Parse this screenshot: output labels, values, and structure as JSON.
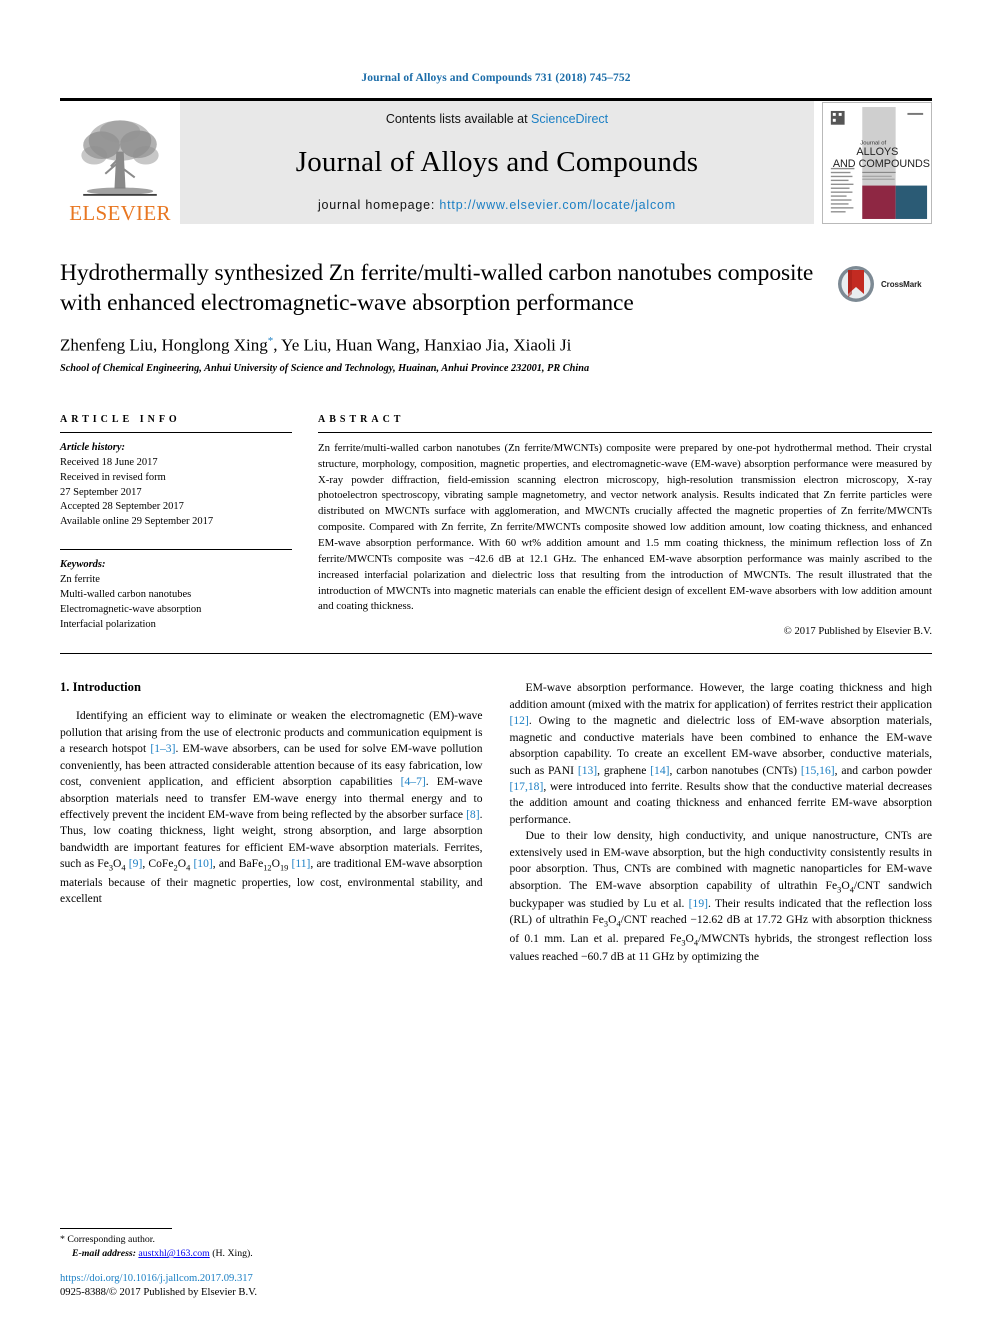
{
  "running_head": "Journal of Alloys and Compounds 731 (2018) 745–752",
  "masthead": {
    "publisher_name": "ELSEVIER",
    "contents_prefix": "Contents lists available at ",
    "contents_link": "ScienceDirect",
    "journal_title": "Journal of Alloys and Compounds",
    "homepage_prefix": "journal homepage: ",
    "homepage_url": "http://www.elsevier.com/locate/jalcom",
    "cover": {
      "line_small_top": "Journal of",
      "line_alloys": "ALLOYS",
      "line_compounds": "AND COMPOUNDS",
      "red_hex": "#8e2743",
      "teal_hex": "#2b5b75",
      "gray_hex": "#cfcfcf"
    }
  },
  "article": {
    "title": "Hydrothermally synthesized Zn ferrite/multi-walled carbon nanotubes composite with enhanced electromagnetic-wave absorption performance",
    "authors_html": "Zhenfeng Liu, Honglong Xing<sup>*</sup>, Ye Liu, Huan Wang, Hanxiao Jia, Xiaoli Ji",
    "affiliation": "School of Chemical Engineering, Anhui University of Science and Technology, Huainan, Anhui Province 232001, PR China",
    "crossmark_label": "CrossMark"
  },
  "article_info": {
    "heading": "ARTICLE INFO",
    "history_label": "Article history:",
    "history": [
      "Received 18 June 2017",
      "Received in revised form",
      "27 September 2017",
      "Accepted 28 September 2017",
      "Available online 29 September 2017"
    ],
    "keywords_label": "Keywords:",
    "keywords": [
      "Zn ferrite",
      "Multi-walled carbon nanotubes",
      "Electromagnetic-wave absorption",
      "Interfacial polarization"
    ]
  },
  "abstract": {
    "heading": "ABSTRACT",
    "text": "Zn ferrite/multi-walled carbon nanotubes (Zn ferrite/MWCNTs) composite were prepared by one-pot hydrothermal method. Their crystal structure, morphology, composition, magnetic properties, and electromagnetic-wave (EM-wave) absorption performance were measured by X-ray powder diffraction, field-emission scanning electron microscopy, high-resolution transmission electron microscopy, X-ray photoelectron spectroscopy, vibrating sample magnetometry, and vector network analysis. Results indicated that Zn ferrite particles were distributed on MWCNTs surface with agglomeration, and MWCNTs crucially affected the magnetic properties of Zn ferrite/MWCNTs composite. Compared with Zn ferrite, Zn ferrite/MWCNTs composite showed low addition amount, low coating thickness, and enhanced EM-wave absorption performance. With 60 wt% addition amount and 1.5 mm coating thickness, the minimum reflection loss of Zn ferrite/MWCNTs composite was −42.6 dB at 12.1 GHz. The enhanced EM-wave absorption performance was mainly ascribed to the increased interfacial polarization and dielectric loss that resulting from the introduction of MWCNTs. The result illustrated that the introduction of MWCNTs into magnetic materials can enable the efficient design of excellent EM-wave absorbers with low addition amount and coating thickness.",
    "copyright": "© 2017 Published by Elsevier B.V."
  },
  "introduction": {
    "section_number_title": "1. Introduction",
    "left_paragraph_html": "Identifying an efficient way to eliminate or weaken the electromagnetic (EM)-wave pollution that arising from the use of electronic products and communication equipment is a research hotspot <span class=\"ref\">[1–3]</span>. EM-wave absorbers, can be used for solve EM-wave pollution conveniently, has been attracted considerable attention because of its easy fabrication, low cost, convenient application, and efficient absorption capabilities <span class=\"ref\">[4–7]</span>. EM-wave absorption materials need to transfer EM-wave energy into thermal energy and to effectively prevent the incident EM-wave from being reflected by the absorber surface <span class=\"ref\">[8]</span>. Thus, low coating thickness, light weight, strong absorption, and large absorption bandwidth are important features for efficient EM-wave absorption materials. Ferrites, such as Fe<sub>3</sub>O<sub>4</sub> <span class=\"ref\">[9]</span>, CoFe<sub>2</sub>O<sub>4</sub> <span class=\"ref\">[10]</span>, and BaFe<sub>12</sub>O<sub>19</sub> <span class=\"ref\">[11]</span>, are traditional EM-wave absorption materials because of their magnetic properties, low cost, environmental stability, and excellent",
    "right_paragraph_1_html": "EM-wave absorption performance. However, the large coating thickness and high addition amount (mixed with the matrix for application) of ferrites restrict their application <span class=\"ref\">[12]</span>. Owing to the magnetic and dielectric loss of EM-wave absorption materials, magnetic and conductive materials have been combined to enhance the EM-wave absorption capability. To create an excellent EM-wave absorber, conductive materials, such as PANI <span class=\"ref\">[13]</span>, graphene <span class=\"ref\">[14]</span>, carbon nanotubes (CNTs) <span class=\"ref\">[15,16]</span>, and carbon powder <span class=\"ref\">[17,18]</span>, were introduced into ferrite. Results show that the conductive material decreases the addition amount and coating thickness and enhanced ferrite EM-wave absorption performance.",
    "right_paragraph_2_html": "Due to their low density, high conductivity, and unique nanostructure, CNTs are extensively used in EM-wave absorption, but the high conductivity consistently results in poor absorption. Thus, CNTs are combined with magnetic nanoparticles for EM-wave absorption. The EM-wave absorption capability of ultrathin Fe<sub>3</sub>O<sub>4</sub>/CNT sandwich buckypaper was studied by Lu et al. <span class=\"ref\">[19]</span>. Their results indicated that the reflection loss (RL) of ultrathin Fe<sub>3</sub>O<sub>4</sub>/CNT reached −12.62 dB at 17.72 GHz with absorption thickness of 0.1 mm. Lan et al. prepared Fe<sub>3</sub>O<sub>4</sub>/MWCNTs hybrids, the strongest reflection loss values reached −60.7 dB at 11 GHz by optimizing the"
  },
  "footer": {
    "corresponding_author": "* Corresponding author.",
    "email_label": "E-mail address:",
    "email": "austxhl@163.com",
    "email_suffix": "(H. Xing).",
    "doi": "https://doi.org/10.1016/j.jallcom.2017.09.317",
    "issn_line": "0925-8388/© 2017 Published by Elsevier B.V."
  },
  "colors": {
    "link_blue": "#1b7fc4",
    "head_blue": "#1b6ca8",
    "elsevier_orange": "#e87722",
    "masthead_gray": "#e8e8e8"
  }
}
